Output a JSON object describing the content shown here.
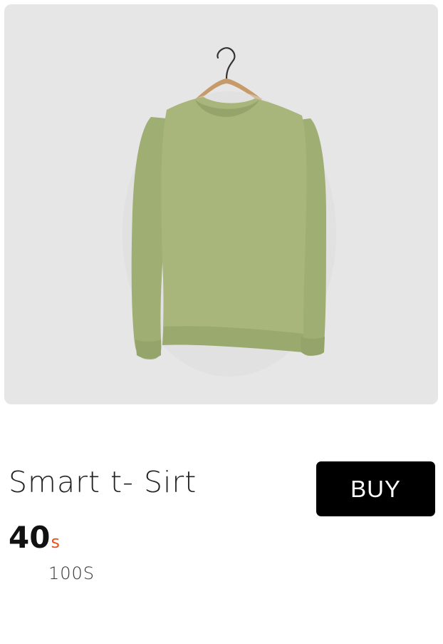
{
  "product": {
    "image_icon": "green-sweatshirt-on-hanger",
    "title": "Smart t- Sirt",
    "price": "40",
    "price_currency": "s",
    "old_price": "100S",
    "buy_label": "BUY"
  },
  "colors": {
    "image_background": "#e6e6e6",
    "garment": "#a8b67c",
    "button_background": "#000000",
    "button_text": "#ffffff",
    "currency_accent": "#e8531a"
  }
}
